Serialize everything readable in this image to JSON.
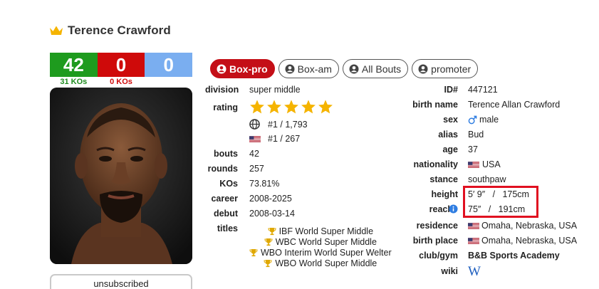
{
  "boxer": {
    "name": "Terence Crawford"
  },
  "record": {
    "wins": "42",
    "losses": "0",
    "draws": "0",
    "win_kos": "31 KOs",
    "loss_kos": "0 KOs"
  },
  "tabs": [
    {
      "label": "Box-pro",
      "active": true
    },
    {
      "label": "Box-am"
    },
    {
      "label": "All Bouts"
    },
    {
      "label": "promoter"
    }
  ],
  "left_info": {
    "division_label": "division",
    "division": "super middle",
    "rating_label": "rating",
    "rating_stars": 5,
    "rank_world": "#1 / 1,793",
    "rank_country": "#1 / 267",
    "bouts_label": "bouts",
    "bouts": "42",
    "rounds_label": "rounds",
    "rounds": "257",
    "kos_label": "KOs",
    "kos": "73.81%",
    "career_label": "career",
    "career": "2008-2025",
    "debut_label": "debut",
    "debut": "2008-03-14",
    "titles_label": "titles",
    "titles": [
      "IBF World Super Middle",
      "WBC World Super Middle",
      "WBO Interim World Super Welter",
      "WBO World Super Middle"
    ]
  },
  "right_info": {
    "id_label": "ID#",
    "id": "447121",
    "birth_name_label": "birth name",
    "birth_name": "Terence Allan Crawford",
    "sex_label": "sex",
    "sex": "male",
    "alias_label": "alias",
    "alias": "Bud",
    "age_label": "age",
    "age": "37",
    "nationality_label": "nationality",
    "nationality": "USA",
    "stance_label": "stance",
    "stance": "southpaw",
    "height_label": "height",
    "height": "5′ 9″   /   175cm",
    "reach_label": "reach",
    "reach": "75″   /   191cm",
    "residence_label": "residence",
    "residence": "Omaha, Nebraska, USA",
    "birth_place_label": "birth place",
    "birth_place": "Omaha, Nebraska, USA",
    "club_label": "club/gym",
    "club": "B&B Sports Academy",
    "wiki_label": "wiki",
    "wiki": "W"
  },
  "subscribe": {
    "label": "unsubscribed"
  },
  "colors": {
    "win": "#1e9b1e",
    "loss": "#cf0a0a",
    "draw": "#7aaef0",
    "accent": "#c40f17",
    "star": "#f5b400",
    "highlight": "#e01020"
  }
}
